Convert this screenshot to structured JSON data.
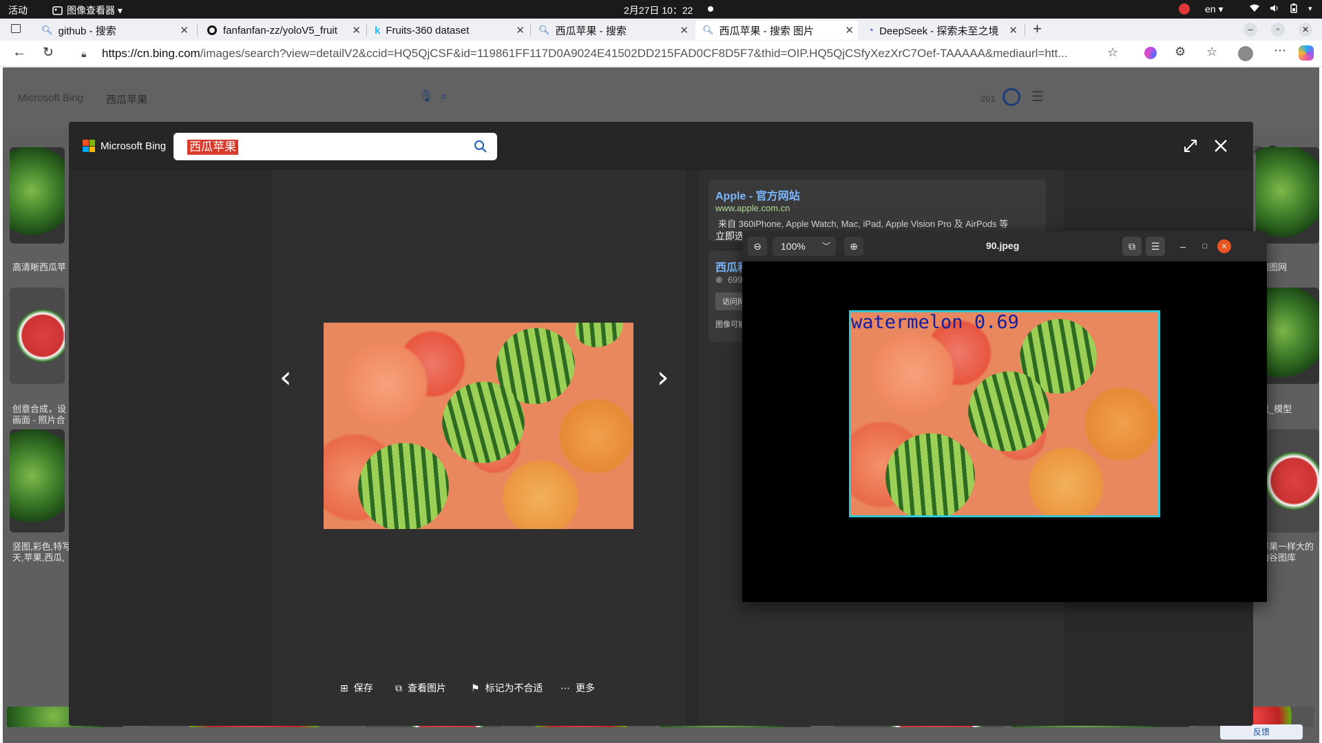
{
  "topbar": {
    "activities": "活动",
    "app_menu": "图像查看器 ▾",
    "clock": "2月27日  10：22",
    "lang": "en ▾"
  },
  "tabs": [
    {
      "title": "github - 搜索"
    },
    {
      "title": "fanfanfan-zz/yoloV5_fruit"
    },
    {
      "title": "Fruits-360 dataset"
    },
    {
      "title": "西瓜苹果 - 搜索"
    },
    {
      "title": "西瓜苹果 - 搜索 图片"
    },
    {
      "title": "DeepSeek - 探索未至之境"
    }
  ],
  "address": {
    "url_host": "https://cn.bing.com",
    "url_rest": "/images/search?view=detailV2&ccid=HQ5QjCSF&id=119861FF117D0A9024E41502DD215FAD0CF8D5F7&thid=OIP.HQ5QjCSfyXezXrC7Oef-TAAAAA&mediaurl=htt..."
  },
  "bg": {
    "logo": "Microsoft Bing",
    "query": "西瓜苹果",
    "header_count": "201",
    "filter_label": "器",
    "captions": {
      "l1": "高清晰西瓜苹",
      "l2a": "创意合成，设",
      "l2b": "画面 - 照片合",
      "l3a": "竖图,彩色,特写",
      "l3b": "天,苹果,西瓜,",
      "r1": "跟图网",
      "r2": "载_模型",
      "r3a": "苹果一样大的",
      "r3b": "山谷图库"
    }
  },
  "overlay": {
    "logo_text": "Microsoft Bing",
    "search_query": "西瓜苹果",
    "actions": [
      {
        "label": "保存"
      },
      {
        "label": "查看图片"
      },
      {
        "label": "标记为不合适"
      },
      {
        "label": "更多"
      }
    ],
    "card1": {
      "title": "Apple - 官方网站",
      "domain": "www.apple.com.cn",
      "snippet": "来自 360iPhone, Apple Watch, Mac, iPad, Apple Vision Pro 及 AirPods 等",
      "cta": "立即选购"
    },
    "card2": {
      "title": "西瓜和",
      "meta": "699",
      "button": "访问网",
      "note": "图像可能受"
    },
    "feedback": "反馈"
  },
  "viewer": {
    "zoom": "100%",
    "filename": "90.jpeg",
    "detection": {
      "label": "watermelon",
      "confidence": "0.69"
    }
  }
}
